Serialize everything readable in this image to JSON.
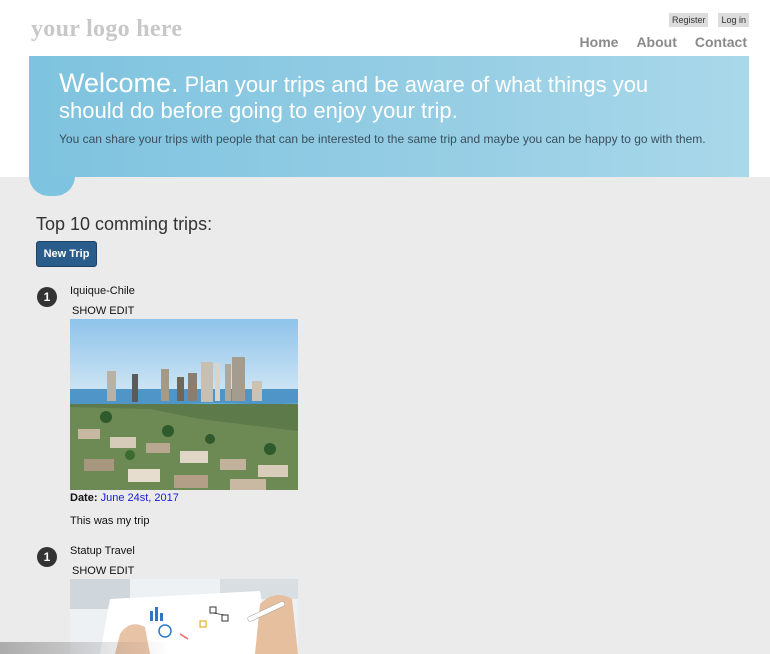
{
  "header": {
    "logo": "your logo here",
    "auth": {
      "register_label": "Register",
      "login_label": "Log in"
    },
    "nav": [
      {
        "label": "Home"
      },
      {
        "label": "About"
      },
      {
        "label": "Contact"
      }
    ]
  },
  "hero": {
    "welcome": "Welcome.",
    "headline": "Plan your trips and be aware of what things you should do before going to enjoy your trip.",
    "subtext": "You can share your trips with people that can be interested to the same trip and maybe you can be happy to go with them."
  },
  "main": {
    "section_title": "Top 10 comming trips:",
    "new_trip_label": "New Trip",
    "trips": [
      {
        "rank": "1",
        "name": "Iquique-Chile",
        "show_label": "SHOW",
        "edit_label": "EDIT",
        "image": "coastal-city-photo",
        "date_label": "Date:",
        "date": "June 24st, 2017",
        "description": "This was my trip"
      },
      {
        "rank": "1",
        "name": "Statup Travel",
        "show_label": "SHOW",
        "edit_label": "EDIT",
        "image": "startup-sketch-photo"
      }
    ]
  },
  "colors": {
    "hero_start": "#7ec3df",
    "hero_end": "#a9d8ea",
    "button": "#2a5d8c",
    "date_link": "#1a1adc",
    "main_bg": "#ebebeb"
  }
}
